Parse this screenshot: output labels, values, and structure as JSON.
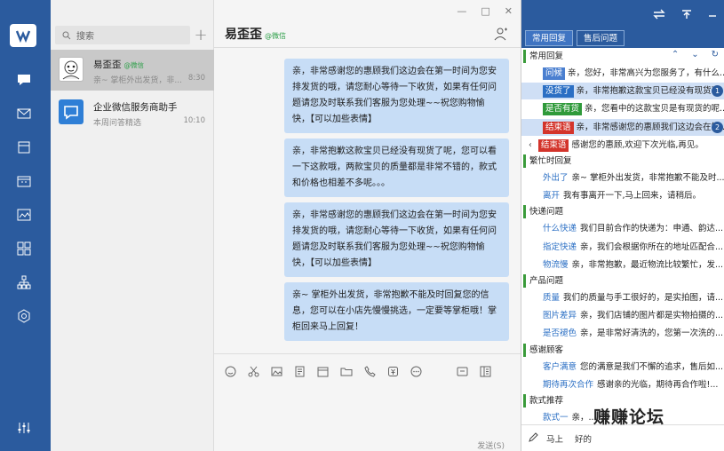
{
  "nav": {
    "icons": [
      "logo-icon",
      "chat-icon",
      "mail-icon",
      "box-icon",
      "calendar-icon",
      "image-icon",
      "apps-icon",
      "org-icon",
      "compass-icon",
      "settings-icon"
    ]
  },
  "convlist": {
    "search_placeholder": "搜索",
    "add_label": "+",
    "items": [
      {
        "name": "易歪歪",
        "tag": "@微信",
        "preview": "亲~ 掌柜外出发货，非...",
        "time": "8:30"
      },
      {
        "name": "企业微信服务商助手",
        "tag": "",
        "preview": "本周问答精选",
        "time": "10:10"
      }
    ]
  },
  "chat": {
    "window_controls": [
      "—",
      "□",
      "✕"
    ],
    "title": "易歪歪",
    "title_tag": "@微信",
    "messages": [
      "亲，非常感谢您的惠顾我们这边会在第一时间为您安排发货的哦，请您耐心等待一下收货，如果有任何问题请您及时联系我们客服为您处理~~祝您购物愉快，【可以加些表情】",
      "亲，非常抱歉这款宝贝已经没有现货了呢，您可以看一下这款哦，两款宝贝的质量都是非常不错的，款式和价格也相差不多呢。。。",
      "亲，非常感谢您的惠顾我们这边会在第一时间为您安排发货的哦，请您耐心等待一下收货，如果有任何问题请您及时联系我们客服为您处理~~祝您购物愉快，【可以加些表情】",
      "亲~ 掌柜外出发货，非常抱歉不能及时回复您的信息，您可以在小店先慢慢挑选，一定要等掌柜哦！掌柜回来马上回复！"
    ],
    "send_label": "发送(S)"
  },
  "quick_reply": {
    "tabs": [
      "常用回复",
      "售后问题"
    ],
    "sections": [
      {
        "title": "常用回复",
        "items": [
          {
            "key": "问候",
            "text": "亲，您好，非常高兴为您服务了，有什么...",
            "badge_color": "#4a7fd0",
            "num": ""
          },
          {
            "key": "没货了",
            "text": "亲，非常抱歉这款宝贝已经没有现货了",
            "badge_color": "#2b6fc4",
            "num": "1"
          },
          {
            "key": "是否有货",
            "text": "亲，您看中的这款宝贝是有现货的呢...",
            "badge_color": "#2f9a3a",
            "num": ""
          },
          {
            "key": "结束语",
            "text": "亲，非常感谢您的惠顾我们这边会在第...",
            "badge_color": "#d3342b",
            "num": "2"
          },
          {
            "key": "结束语",
            "text": "感谢您的惠顾,欢迎下次光临,再见。",
            "badge_color": "#d3342b",
            "num": ""
          }
        ]
      },
      {
        "title": "繁忙时回复",
        "items": [
          {
            "key": "外出了",
            "text": "亲~ 掌柜外出发货，非常抱歉不能及时...",
            "badge_color": "",
            "num": ""
          },
          {
            "key": "离开",
            "text": "我有事离开一下,马上回来，请稍后。",
            "badge_color": "",
            "num": ""
          }
        ]
      },
      {
        "title": "快递问题",
        "items": [
          {
            "key": "什么快递",
            "text": "我们目前合作的快递为：申通、韵达...",
            "badge_color": "",
            "num": ""
          },
          {
            "key": "指定快递",
            "text": "亲，我们会根据你所在的地址匹配合...",
            "badge_color": "",
            "num": ""
          },
          {
            "key": "物流慢",
            "text": "亲，非常抱歉，最近物流比较繁忙，发...",
            "badge_color": "",
            "num": ""
          }
        ]
      },
      {
        "title": "产品问题",
        "items": [
          {
            "key": "质量",
            "text": "我们的质量与手工很好的，是实拍图，请...",
            "badge_color": "",
            "num": ""
          },
          {
            "key": "图片差异",
            "text": "亲，我们店铺的图片都是实物拍摄的...",
            "badge_color": "",
            "num": ""
          },
          {
            "key": "是否褪色",
            "text": "亲，是非常好清洗的，您第一次洗的...",
            "badge_color": "",
            "num": ""
          }
        ]
      },
      {
        "title": "感谢顾客",
        "items": [
          {
            "key": "客户满意",
            "text": "您的满意是我们不懈的追求，售后如...",
            "badge_color": "",
            "num": ""
          },
          {
            "key": "期待再次合作",
            "text": "感谢亲的光临，期待再合作啦!...",
            "badge_color": "",
            "num": ""
          }
        ]
      },
      {
        "title": "款式推荐",
        "items": [
          {
            "key": "款式一",
            "text": "亲，...",
            "badge_color": "",
            "num": ""
          }
        ]
      }
    ],
    "bottom": {
      "shortcut": "马上",
      "text": "好的"
    }
  },
  "watermark": "赚赚论坛",
  "colors": {
    "brand": "#2b5b9e",
    "bubble": "#c7ddf6",
    "green": "#3a9b3a"
  }
}
